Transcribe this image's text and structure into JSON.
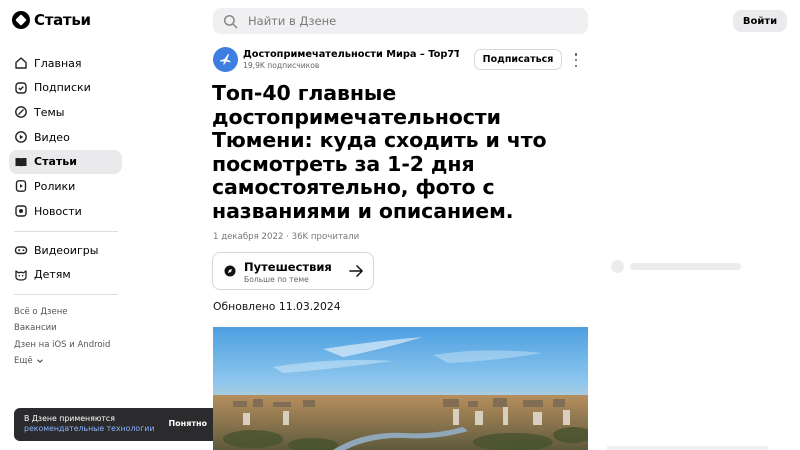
{
  "app": {
    "logo_text": "Статьи"
  },
  "sidebar": {
    "items": [
      {
        "label": "Главная",
        "icon": "home-icon"
      },
      {
        "label": "Подписки",
        "icon": "subscriptions-icon"
      },
      {
        "label": "Темы",
        "icon": "topics-icon"
      },
      {
        "label": "Видео",
        "icon": "video-icon"
      },
      {
        "label": "Статьи",
        "icon": "articles-icon",
        "active": true
      },
      {
        "label": "Ролики",
        "icon": "shorts-icon"
      },
      {
        "label": "Новости",
        "icon": "news-icon"
      }
    ],
    "items2": [
      {
        "label": "Видеоигры",
        "icon": "gamepad-icon"
      },
      {
        "label": "Детям",
        "icon": "kids-icon"
      }
    ],
    "footer": [
      "Всё о Дзене",
      "Вакансии",
      "Дзен на iOS и Android"
    ],
    "more_label": "Ещё"
  },
  "cookie": {
    "line1": "В Дзене применяются",
    "link": "рекомендательные технологии",
    "ok_label": "Понятно"
  },
  "search": {
    "placeholder": "Найти в Дзене"
  },
  "header": {
    "login_label": "Войти"
  },
  "channel": {
    "name": "Достопримечательности Мира – Top7Tra...",
    "subscribers": "19,9K подписчиков",
    "subscribe_label": "Подписаться"
  },
  "article": {
    "title": "Топ-40 главные достопримечательности Тюмени: куда сходить и что посмотреть за 1-2 дня самостоятельно, фото с названиями и описанием.",
    "meta": "1 декабря 2022 · 36K прочитали",
    "topic_title": "Путешествия",
    "topic_sub": "Больше по теме",
    "updated": "Обновлено 11.03.2024"
  },
  "colors": {
    "accent": "#3d7ee0",
    "active_bg": "#eaeaed",
    "cookie_bg": "#2b2b2e"
  }
}
